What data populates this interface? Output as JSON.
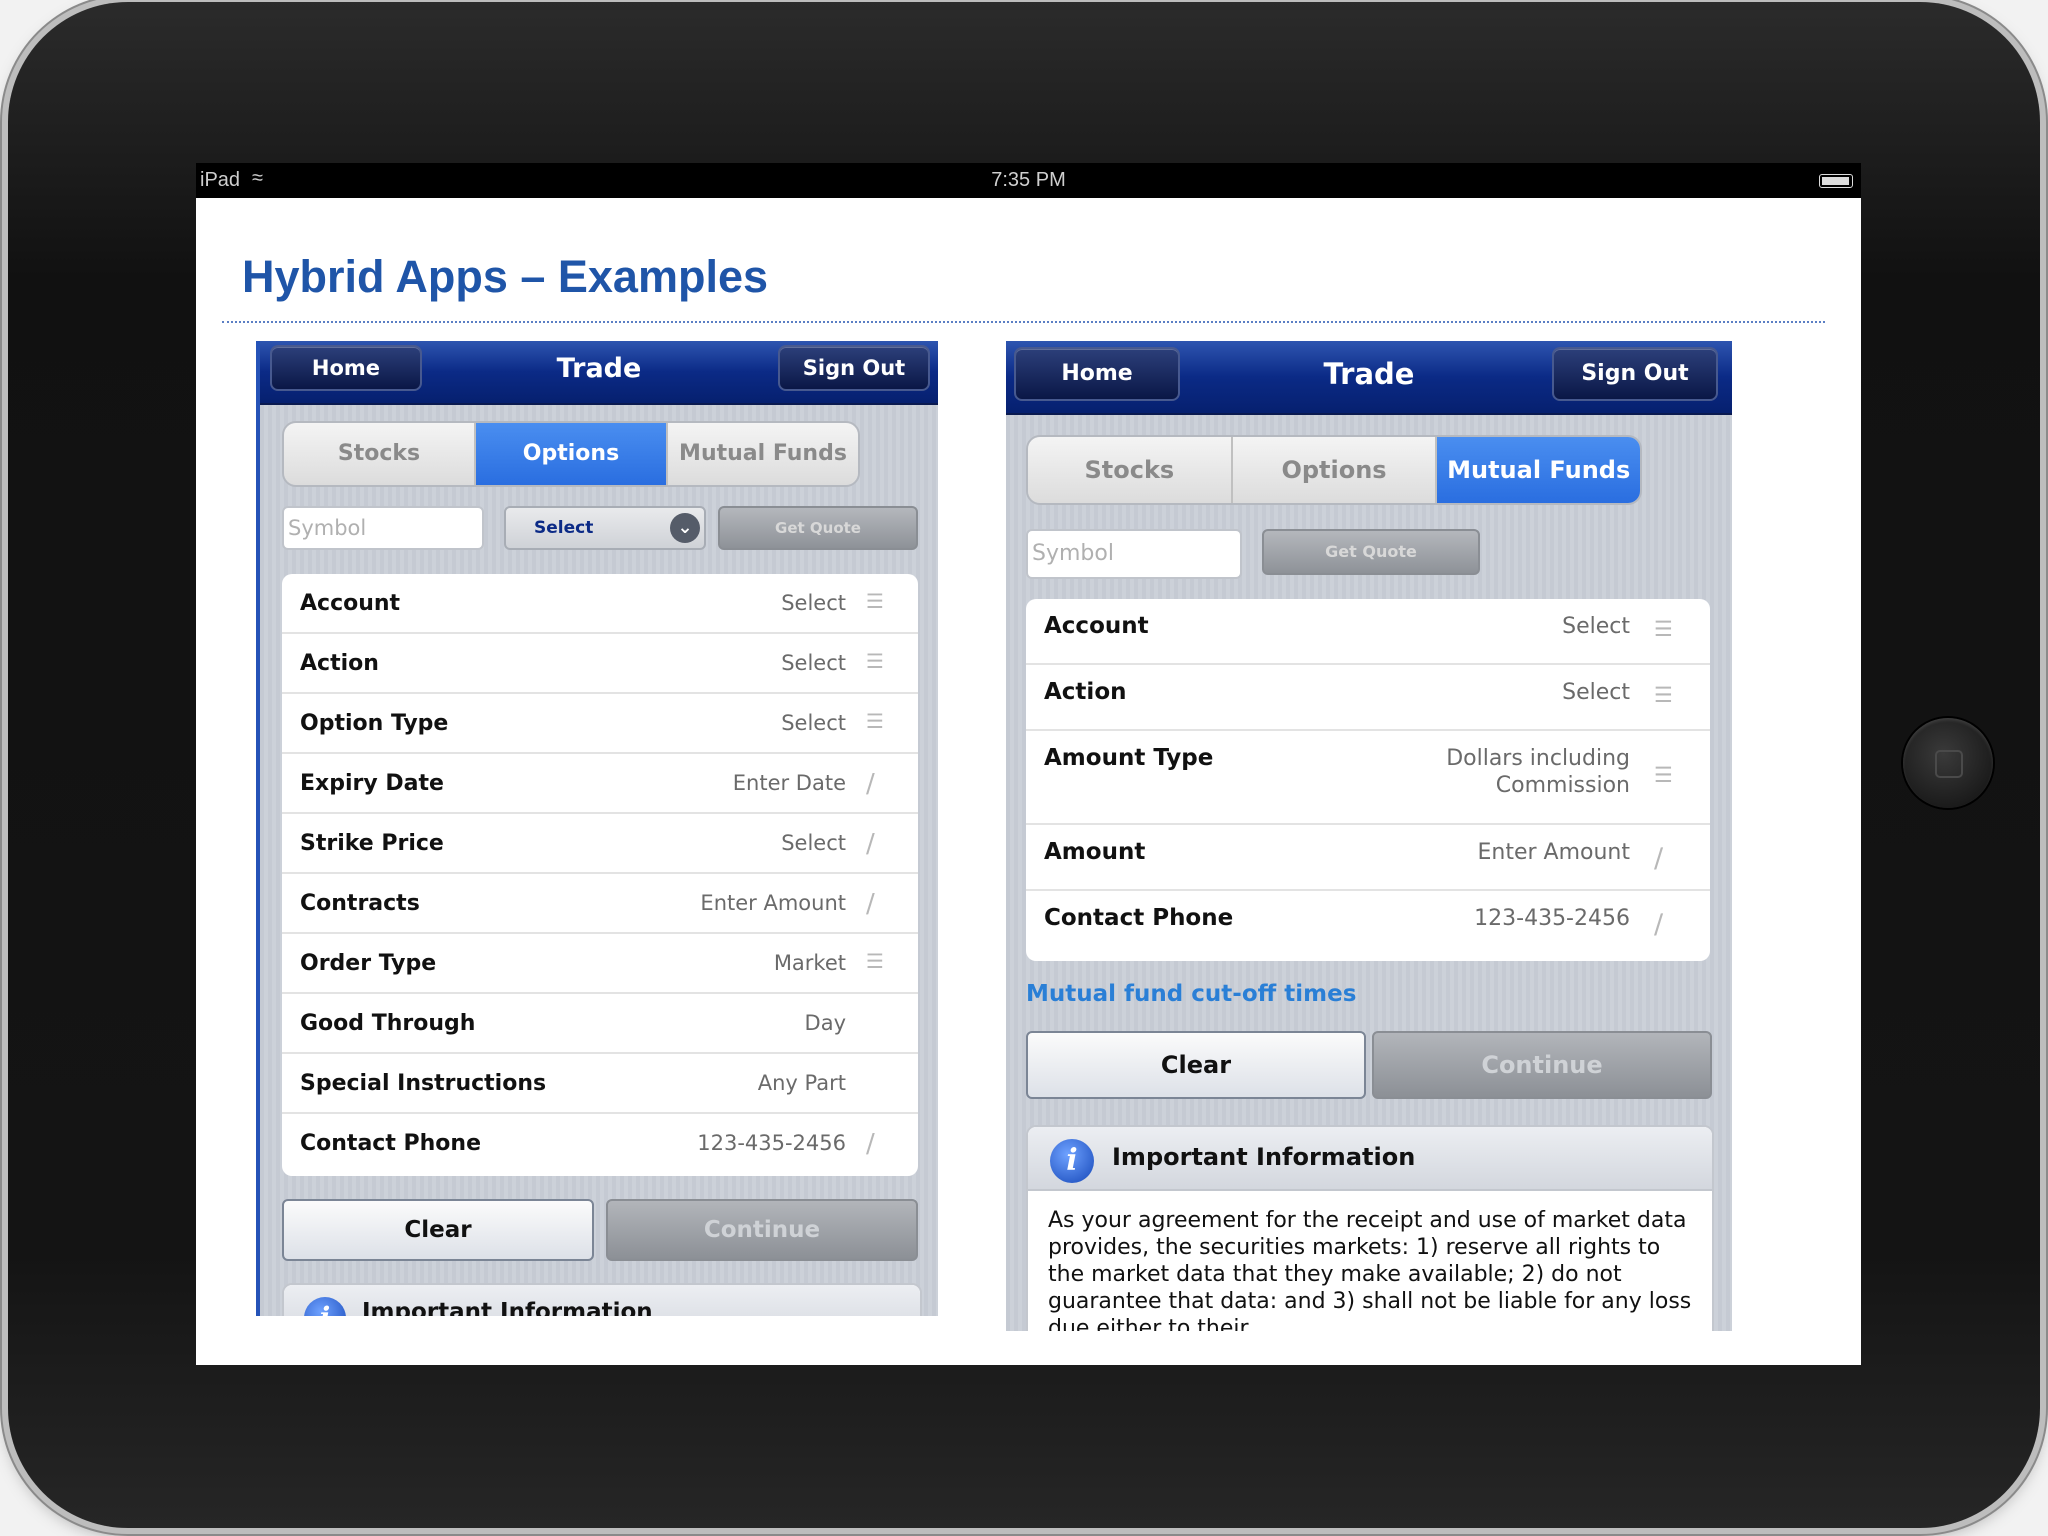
{
  "device": {
    "name": "iPad"
  },
  "status_bar": {
    "carrier": "iPad",
    "wifi_icon": "wifi-icon",
    "time": "7:35 PM"
  },
  "slide": {
    "title": "Hybrid Apps – Examples"
  },
  "left_app": {
    "nav": {
      "home": "Home",
      "title": "Trade",
      "sign_out": "Sign Out"
    },
    "tabs": [
      {
        "label": "Stocks"
      },
      {
        "label": "Options",
        "active": true
      },
      {
        "label": "Mutual Funds"
      }
    ],
    "symbol_placeholder": "Symbol",
    "select_label": "Select",
    "get_quote": "Get Quote",
    "rows": [
      {
        "label": "Account",
        "value": "Select",
        "icon": "list-icon"
      },
      {
        "label": "Action",
        "value": "Select",
        "icon": "list-icon"
      },
      {
        "label": "Option Type",
        "value": "Select",
        "icon": "list-icon"
      },
      {
        "label": "Expiry Date",
        "value": "Enter Date",
        "icon": "pencil-icon"
      },
      {
        "label": "Strike Price",
        "value": "Select",
        "icon": "pencil-icon"
      },
      {
        "label": "Contracts",
        "value": "Enter Amount",
        "icon": "pencil-icon"
      },
      {
        "label": "Order Type",
        "value": "Market",
        "icon": "list-icon"
      },
      {
        "label": "Good Through",
        "value": "Day",
        "icon": ""
      },
      {
        "label": "Special Instructions",
        "value": "Any Part",
        "icon": ""
      },
      {
        "label": "Contact Phone",
        "value": "123-435-2456",
        "icon": "pencil-icon"
      }
    ],
    "clear": "Clear",
    "continue": "Continue",
    "info_title": "Important Information"
  },
  "right_app": {
    "nav": {
      "home": "Home",
      "title": "Trade",
      "sign_out": "Sign Out"
    },
    "tabs": [
      {
        "label": "Stocks"
      },
      {
        "label": "Options"
      },
      {
        "label": "Mutual Funds",
        "active": true
      }
    ],
    "symbol_placeholder": "Symbol",
    "get_quote": "Get Quote",
    "rows": [
      {
        "label": "Account",
        "value": "Select",
        "icon": "list-icon"
      },
      {
        "label": "Action",
        "value": "Select",
        "icon": "list-icon"
      },
      {
        "label": "Amount Type",
        "value": "Dollars including Commission",
        "icon": "list-icon"
      },
      {
        "label": "Amount",
        "value": "Enter Amount",
        "icon": "pencil-icon"
      },
      {
        "label": "Contact Phone",
        "value": "123-435-2456",
        "icon": "pencil-icon"
      }
    ],
    "cutoff_link": "Mutual fund cut-off times",
    "clear": "Clear",
    "continue": "Continue",
    "info_title": "Important Information",
    "info_text": "As your agreement for the receipt and use of market data provides, the securities markets: 1) reserve all rights to the market data that they make available; 2) do not guarantee that data: and 3) shall not be liable for any loss due either to their"
  },
  "colors": {
    "title_blue": "#1f55a8",
    "nav_blue": "#0b2a86",
    "tab_active": "#2a6ee0",
    "link_blue": "#2a7fd6"
  }
}
